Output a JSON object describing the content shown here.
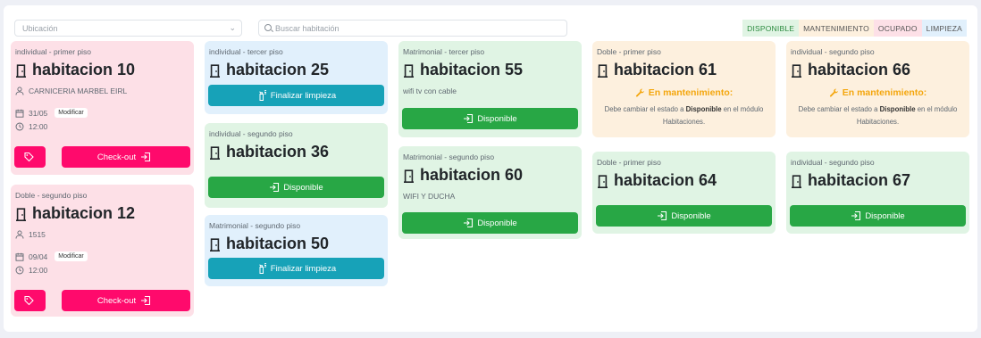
{
  "filters": {
    "ubicacion_placeholder": "Ubicación",
    "search_placeholder": "Buscar habitación"
  },
  "legend": [
    {
      "label": "DISPONIBLE",
      "bg": "#e0f4e4",
      "color": "#2a8a3e"
    },
    {
      "label": "MANTENIMIENTO",
      "bg": "#fdf0de",
      "color": "#555"
    },
    {
      "label": "OCUPADO",
      "bg": "#fde0e7",
      "color": "#555"
    },
    {
      "label": "LIMPIEZA",
      "bg": "#e1f0fc",
      "color": "#555"
    }
  ],
  "rooms": {
    "r10": {
      "sub": "individual - primer piso",
      "title": "habitacion 10",
      "guest": "CARNICERIA MARBEL EIRL",
      "date": "31/05",
      "modify": "Modificar",
      "time": "12:00",
      "checkout": "Check-out"
    },
    "r12": {
      "sub": "Doble - segundo piso",
      "title": "habitacion 12",
      "guest": "1515",
      "date": "09/04",
      "modify": "Modificar",
      "time": "12:00",
      "checkout": "Check-out"
    },
    "r25": {
      "sub": "individual - tercer piso",
      "title": "habitacion 25",
      "action": "Finalizar limpieza"
    },
    "r36": {
      "sub": "individual - segundo piso",
      "title": "habitacion 36",
      "action": "Disponible"
    },
    "r50": {
      "sub": "Matrimonial - segundo piso",
      "title": "habitacion 50",
      "action": "Finalizar limpieza"
    },
    "r55": {
      "sub": "Matrimonial - tercer piso",
      "title": "habitacion 55",
      "note": "wifi tv con cable",
      "action": "Disponible"
    },
    "r60": {
      "sub": "Matrimonial - segundo piso",
      "title": "habitacion 60",
      "note": "WIFI Y DUCHA",
      "action": "Disponible"
    },
    "r61": {
      "sub": "Doble - primer piso",
      "title": "habitacion 61",
      "mant_title": "En mantenimiento:",
      "mant_pre": "Debe cambiar el estado a ",
      "mant_bold": "Disponible",
      "mant_post": " en el módulo Habitaciones."
    },
    "r64": {
      "sub": "Doble - primer piso",
      "title": "habitacion 64",
      "action": "Disponible"
    },
    "r66": {
      "sub": "individual - segundo piso",
      "title": "habitacion 66",
      "mant_title": "En mantenimiento:",
      "mant_pre": "Debe cambiar el estado a ",
      "mant_bold": "Disponible",
      "mant_post": " en el módulo Habitaciones."
    },
    "r67": {
      "sub": "individual - segundo piso",
      "title": "habitacion 67",
      "action": "Disponible"
    }
  },
  "colors": {
    "ocupado": "#fde0e7",
    "limpieza": "#e1f0fc",
    "disponible": "#e0f4e4",
    "mantenimiento": "#fdf0de",
    "btn_green": "#28a745",
    "btn_teal": "#17a2b8",
    "btn_pink": "#ff0a6c"
  }
}
